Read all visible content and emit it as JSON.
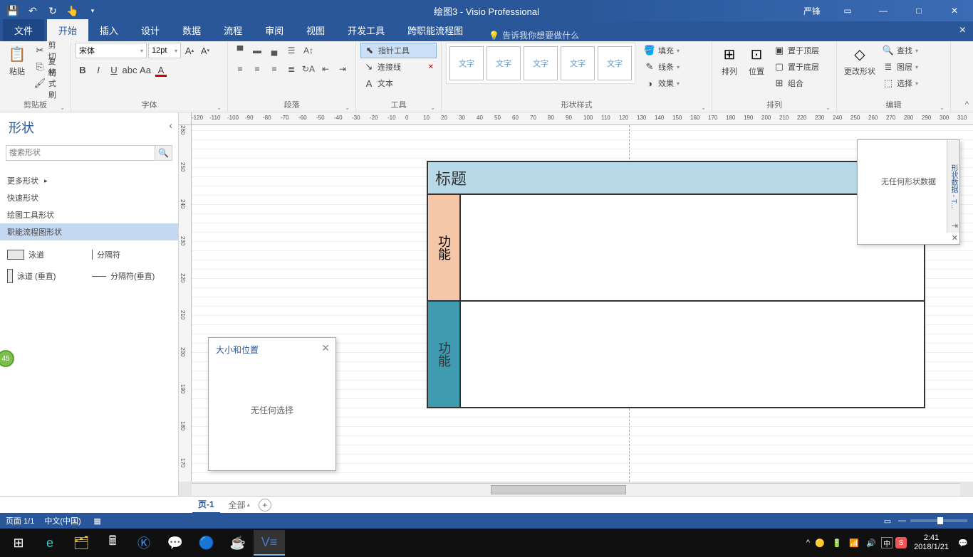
{
  "titlebar": {
    "doc_title": "绘图3",
    "app_name": "Visio Professional",
    "user": "严锋"
  },
  "ribbon_tabs": {
    "file": "文件",
    "home": "开始",
    "insert": "插入",
    "design": "设计",
    "data": "数据",
    "process": "流程",
    "review": "审阅",
    "view": "视图",
    "dev": "开发工具",
    "cross": "跨职能流程图",
    "tell_me": "告诉我你想要做什么"
  },
  "ribbon": {
    "clipboard": {
      "paste": "粘贴",
      "cut": "剪切",
      "copy": "复制",
      "format_painter": "格式刷",
      "label": "剪贴板"
    },
    "font": {
      "name": "宋体",
      "size": "12pt",
      "label": "字体"
    },
    "paragraph": {
      "label": "段落"
    },
    "tools": {
      "pointer": "指针工具",
      "connector": "连接线",
      "text": "文本",
      "label": "工具"
    },
    "shape_styles": {
      "sample": "文字",
      "fill": "填充",
      "line": "线条",
      "effects": "效果",
      "label": "形状样式"
    },
    "arrange": {
      "align": "排列",
      "position": "位置",
      "bring_front": "置于顶层",
      "send_back": "置于底层",
      "group": "组合",
      "label": "排列"
    },
    "edit": {
      "change_shape": "更改形状",
      "find": "查找",
      "layers": "图层",
      "select": "选择",
      "label": "编辑"
    }
  },
  "shapes_panel": {
    "title": "形状",
    "search_placeholder": "搜索形状",
    "more": "更多形状",
    "quick": "快速形状",
    "drawing_tools": "绘图工具形状",
    "cross_func": "职能流程图形状",
    "stencil": {
      "swimlane_h": "泳道",
      "separator_h": "分隔符",
      "swimlane_v": "泳道 (垂直)",
      "separator_v": "分隔符(垂直)"
    }
  },
  "canvas": {
    "title": "标题",
    "lane1": "功能",
    "lane2": "功能"
  },
  "size_panel": {
    "title": "大小和位置",
    "empty": "无任何选择"
  },
  "shape_data": {
    "tab": "形状数据 - T...",
    "empty": "无任何形状数据"
  },
  "page_badge": "45",
  "page_tabs": {
    "page1": "页-1",
    "all": "全部"
  },
  "statusbar": {
    "page": "页面 1/1",
    "lang": "中文(中国)"
  },
  "taskbar": {
    "time": "2:41",
    "date": "2018/1/21",
    "ime": "中"
  }
}
